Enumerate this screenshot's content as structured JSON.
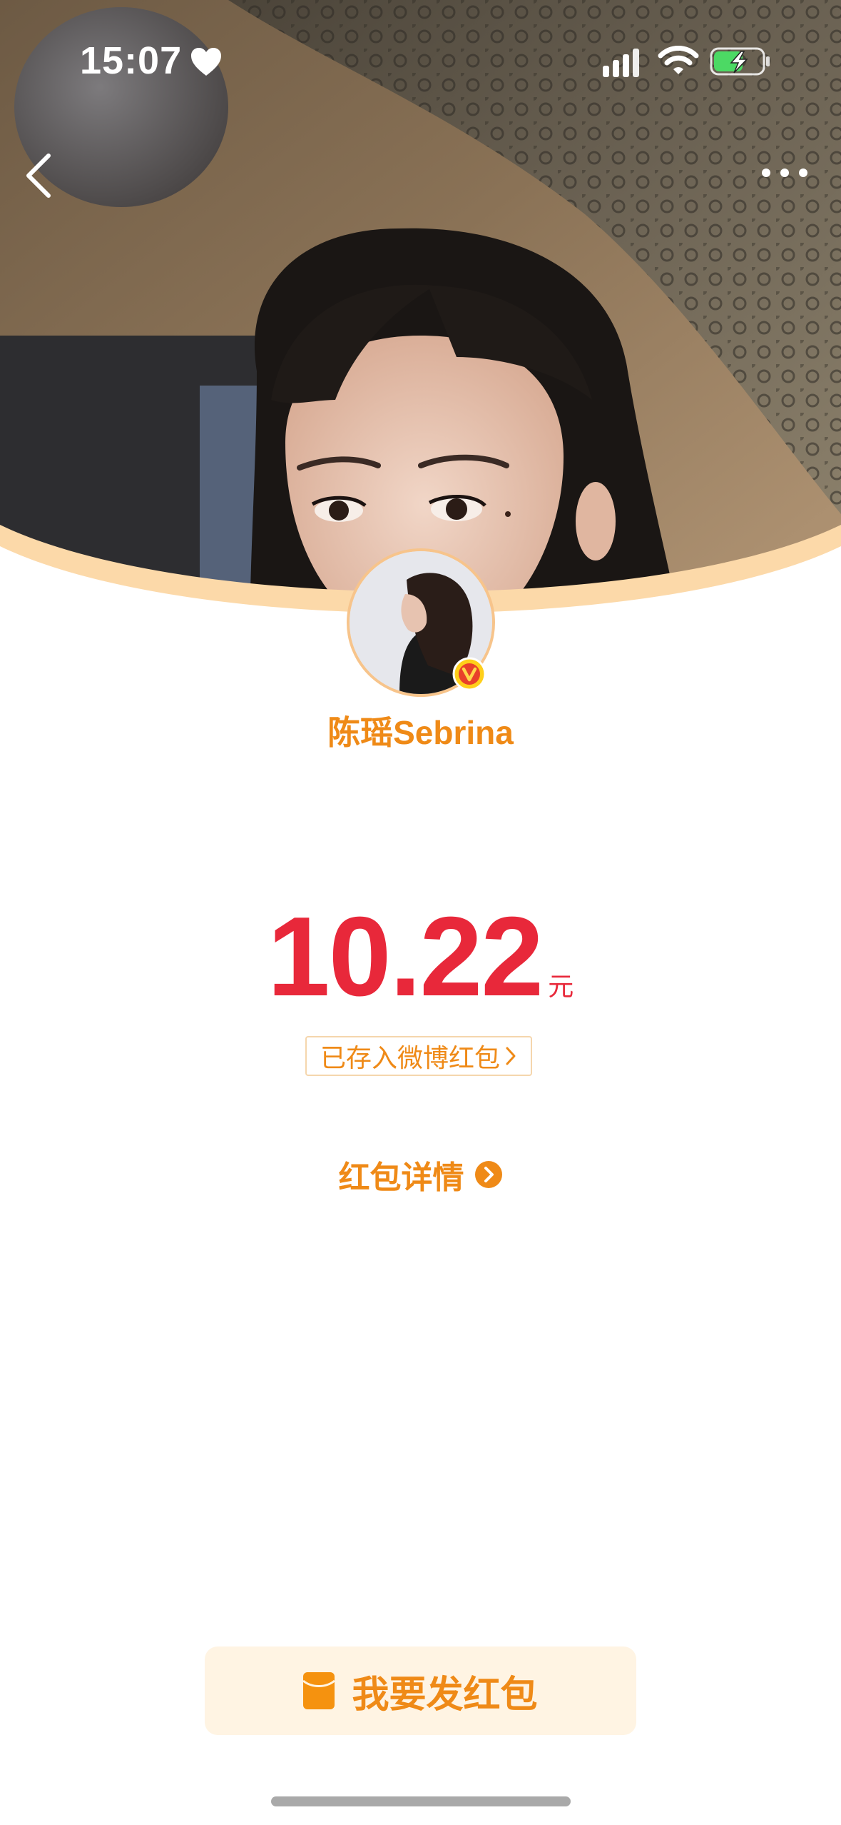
{
  "status_bar": {
    "time": "15:07",
    "icons": [
      "heart-icon",
      "signal-icon",
      "wifi-icon",
      "battery-charging-icon"
    ]
  },
  "nav": {
    "back_icon": "chevron-left-icon",
    "more_icon": "more-dots-icon"
  },
  "sender": {
    "name": "陈瑶Sebrina",
    "verified_badge": "V"
  },
  "red_packet": {
    "amount": "10.22",
    "unit": "元",
    "saved_text": "已存入微博红包",
    "detail_label": "红包详情"
  },
  "footer": {
    "send_button_label": "我要发红包",
    "send_icon": "red-envelope-icon"
  },
  "colors": {
    "accent_orange": "#ef8a17",
    "amount_red": "#e8283a",
    "button_bg": "#fff4e3",
    "hero_curve": "#fcd9a9"
  }
}
